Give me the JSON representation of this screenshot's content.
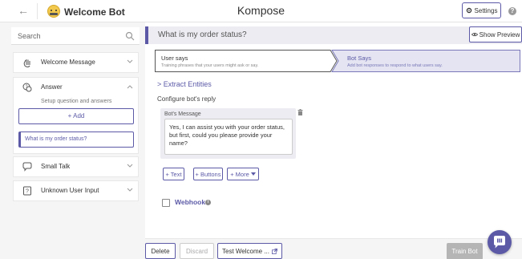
{
  "app": {
    "title": "Kompose"
  },
  "bot": {
    "name": "Welcome Bot"
  },
  "header": {
    "settings_label": "Settings",
    "help_symbol": "?"
  },
  "sidebar": {
    "search_placeholder": "Search",
    "items": [
      {
        "label": "Welcome Message",
        "icon": "hand-wave-icon"
      },
      {
        "label": "Answer",
        "icon": "chat-question-icon",
        "subtitle": "Setup question and answers",
        "add_label": "+ Add",
        "questions": [
          "What is my order status?"
        ]
      },
      {
        "label": "Small Talk",
        "icon": "small-talk-icon"
      },
      {
        "label": "Unknown User Input",
        "icon": "unknown-input-icon"
      }
    ]
  },
  "main": {
    "question_title": "What is my order status?",
    "preview_label": "Show Preview",
    "steps": [
      {
        "title": "User says",
        "subtitle": "Training phrases that your users might ask or say."
      },
      {
        "title": "Bot Says",
        "subtitle": "Add bot responses to respond to what users say."
      }
    ],
    "extract_entities": "> Extract Entities",
    "configure_label": "Configure bot's reply",
    "bot_message": {
      "label": "Bot's Message",
      "text": "Yes, I can assist you with your order status, but first, could you please provide your name?"
    },
    "actions": {
      "text": "+ Text",
      "buttons": "+ Buttons",
      "more": "+ More"
    },
    "webhook": {
      "label": "Webhook",
      "info_symbol": "i",
      "checked": false
    }
  },
  "footer": {
    "delete": "Delete",
    "discard": "Discard",
    "test": "Test Welcome ...",
    "train": "Train Bot"
  },
  "colors": {
    "accent": "#5c5aa7",
    "panel": "#ececf2",
    "sidebar_bg": "#f5f5f5"
  }
}
